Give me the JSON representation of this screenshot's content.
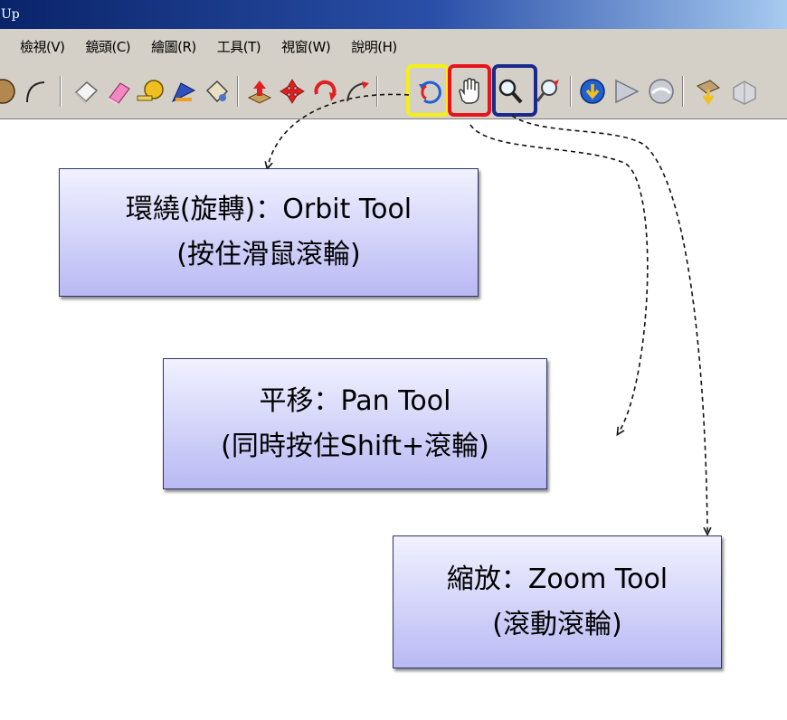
{
  "window": {
    "title": "Up"
  },
  "menu": [
    {
      "label": "檢視(V)"
    },
    {
      "label": "鏡頭(C)"
    },
    {
      "label": "繪圖(R)"
    },
    {
      "label": "工具(T)"
    },
    {
      "label": "視窗(W)"
    },
    {
      "label": "說明(H)"
    }
  ],
  "toolbar": {
    "icons": [
      "circle-icon",
      "arc-icon",
      "eraser-icon",
      "paint-eraser-icon",
      "tape-measure-icon",
      "protractor-icon",
      "paint-bucket-icon",
      "push-pull-icon",
      "move-icon",
      "rotate-icon",
      "follow-me-icon",
      "orbit-icon",
      "pan-icon",
      "zoom-icon",
      "zoom-window-icon",
      "zoom-extents-icon",
      "previous-view-icon",
      "next-view-icon",
      "section-icon",
      "component-icon"
    ],
    "highlight_colors": {
      "orbit": "#f4f016",
      "pan": "#e8141c",
      "zoom": "#1a2a8c"
    }
  },
  "callouts": {
    "orbit": {
      "line1": "環繞(旋轉)：Orbit Tool",
      "line2": "(按住滑鼠滾輪)"
    },
    "pan": {
      "line1": "平移：Pan Tool",
      "line2": "(同時按住Shift+滾輪)"
    },
    "zoom": {
      "line1": "縮放：Zoom Tool",
      "line2": "(滾動滾輪)"
    }
  }
}
